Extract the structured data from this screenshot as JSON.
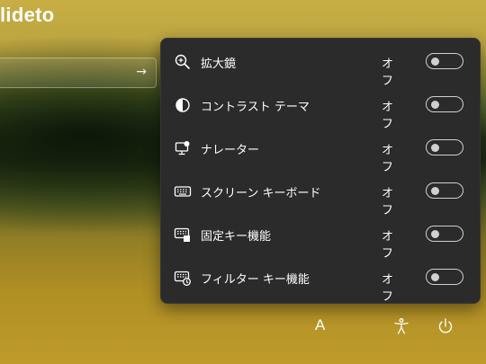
{
  "user": {
    "name": "lideto"
  },
  "signin": {
    "submit_icon": "arrow-right-icon"
  },
  "accessibility_panel": {
    "items": [
      {
        "icon": "magnifier-icon",
        "label": "拡大鏡",
        "state": "オフ",
        "on": false
      },
      {
        "icon": "contrast-icon",
        "label": "コントラスト テーマ",
        "state": "オフ",
        "on": false
      },
      {
        "icon": "narrator-icon",
        "label": "ナレーター",
        "state": "オフ",
        "on": false
      },
      {
        "icon": "keyboard-icon",
        "label": "スクリーン キーボード",
        "state": "オフ",
        "on": false
      },
      {
        "icon": "sticky-keys-icon",
        "label": "固定キー機能",
        "state": "オフ",
        "on": false
      },
      {
        "icon": "filter-keys-icon",
        "label": "フィルター キー機能",
        "state": "オフ",
        "on": false
      }
    ]
  },
  "taskbar": {
    "input_indicator": "A",
    "accessibility_icon": "accessibility-icon",
    "power_icon": "power-icon"
  },
  "colors": {
    "panel_bg": "#2b2b2b",
    "text": "#ffffff",
    "toggle_off": "#d0d0d0"
  }
}
